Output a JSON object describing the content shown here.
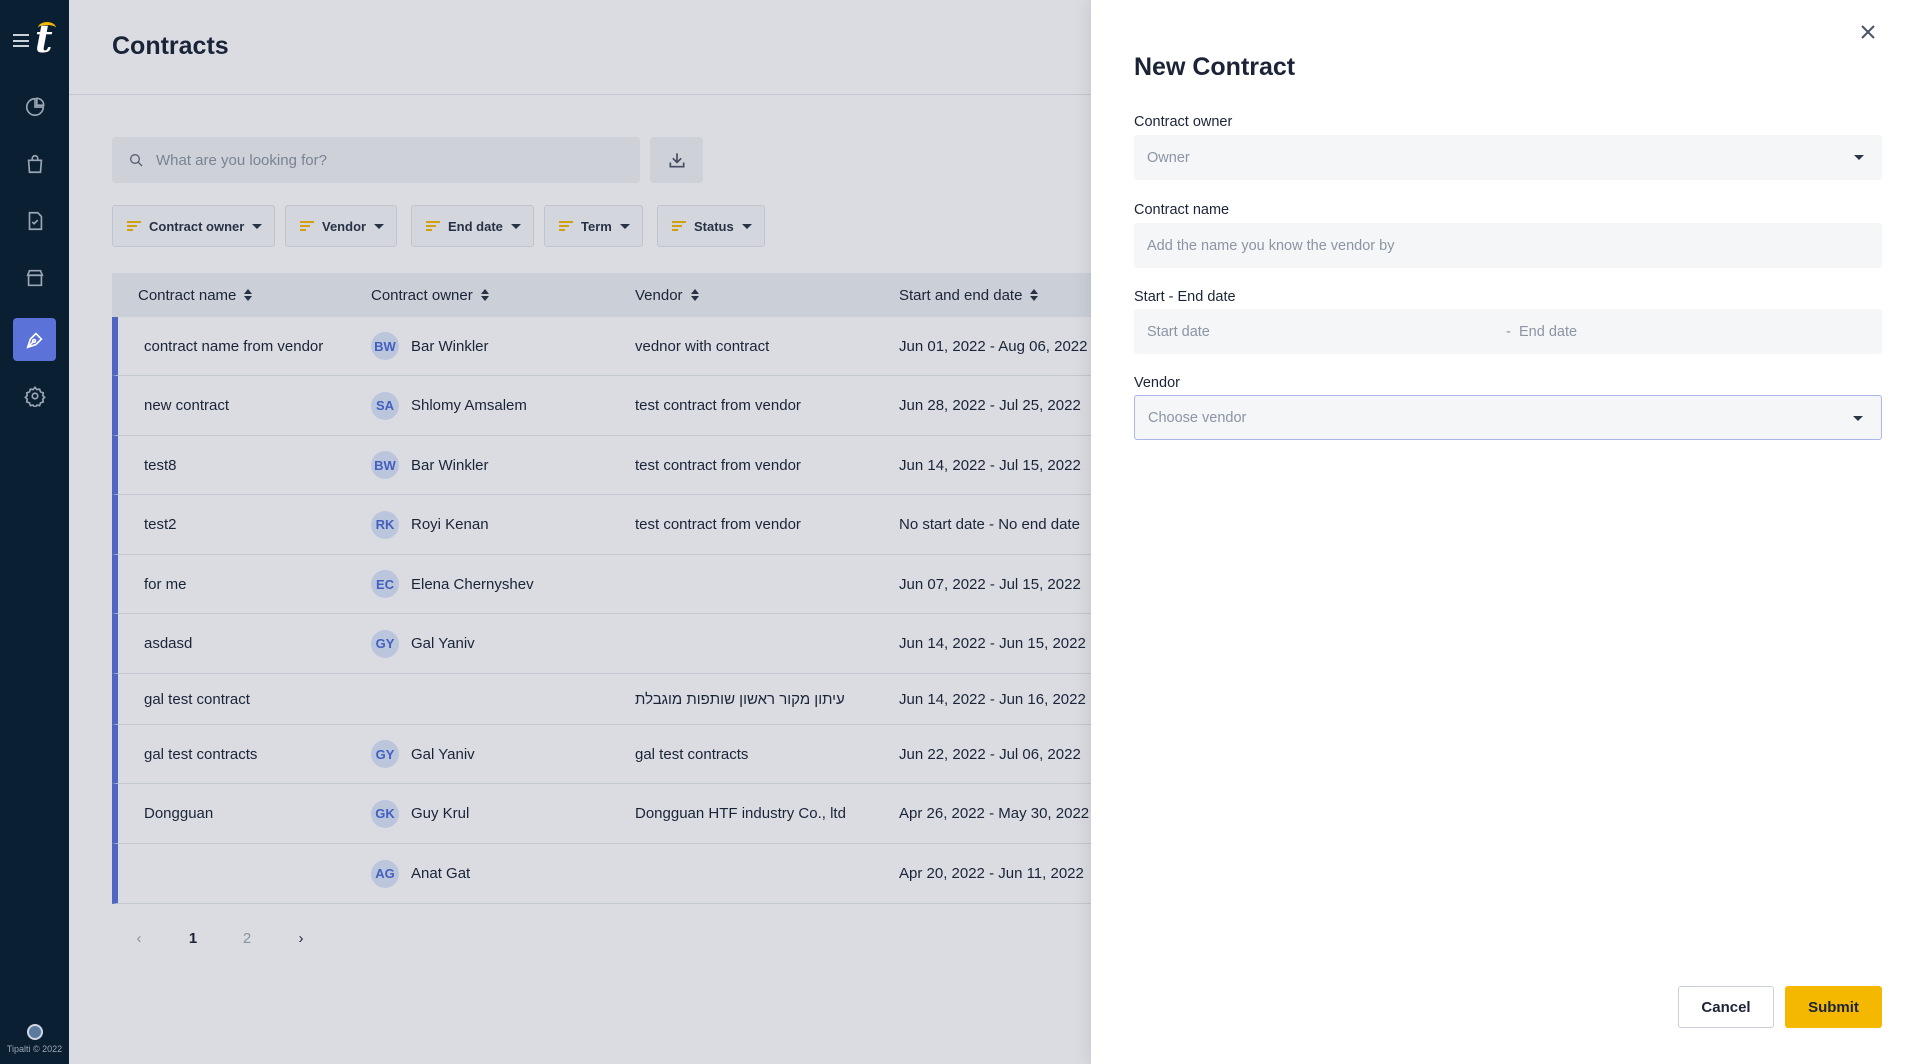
{
  "sidebar": {
    "logo_text": "t",
    "footer_text": "Tipalti © 2022",
    "nav_icons": [
      "pie-chart-icon",
      "shopping-bag-icon",
      "document-check-icon",
      "store-icon",
      "pen-icon",
      "gear-icon"
    ],
    "active_item": "pen-icon"
  },
  "page": {
    "title": "Contracts",
    "search_placeholder": "What are you looking for?",
    "filters": [
      "Contract owner",
      "Vendor",
      "End date",
      "Term",
      "Status"
    ]
  },
  "table": {
    "columns": [
      "Contract name",
      "Contract owner",
      "Vendor",
      "Start and end date"
    ],
    "rows": [
      {
        "name": "contract name from vendor",
        "initials": "BW",
        "owner": "Bar Winkler",
        "vendor": "vednor with contract",
        "dates": "Jun 01, 2022 - Aug 06, 2022"
      },
      {
        "name": "new contract",
        "initials": "SA",
        "owner": "Shlomy Amsalem",
        "vendor": "test contract from vendor",
        "dates": "Jun 28, 2022 - Jul 25, 2022"
      },
      {
        "name": "test8",
        "initials": "BW",
        "owner": "Bar Winkler",
        "vendor": "test contract from vendor",
        "dates": "Jun 14, 2022 - Jul 15, 2022"
      },
      {
        "name": "test2",
        "initials": "RK",
        "owner": "Royi Kenan",
        "vendor": "test contract from vendor",
        "dates": "No start date - No end date"
      },
      {
        "name": "for me",
        "initials": "EC",
        "owner": "Elena Chernyshev",
        "vendor": "",
        "dates": "Jun 07, 2022 - Jul 15, 2022"
      },
      {
        "name": "asdasd",
        "initials": "GY",
        "owner": "Gal Yaniv",
        "vendor": "",
        "dates": "Jun 14, 2022 - Jun 15, 2022"
      },
      {
        "name": "gal test contract",
        "initials": "",
        "owner": "",
        "vendor": "עיתון מקור ראשון שותפות מוגבלת",
        "dates": "Jun 14, 2022 - Jun 16, 2022"
      },
      {
        "name": "gal test contracts",
        "initials": "GY",
        "owner": "Gal Yaniv",
        "vendor": "gal test contracts",
        "dates": "Jun 22, 2022 - Jul 06, 2022"
      },
      {
        "name": "Dongguan",
        "initials": "GK",
        "owner": "Guy Krul",
        "vendor": "Dongguan HTF industry Co., ltd",
        "dates": "Apr 26, 2022 - May 30, 2022"
      },
      {
        "name": "",
        "initials": "AG",
        "owner": "Anat Gat",
        "vendor": "",
        "dates": "Apr 20, 2022 - Jun 11, 2022"
      }
    ]
  },
  "pagination": {
    "pages": [
      "1",
      "2"
    ],
    "current": "1"
  },
  "drawer": {
    "title": "New Contract",
    "owner_label": "Contract owner",
    "owner_placeholder": "Owner",
    "name_label": "Contract name",
    "name_placeholder": "Add the name you know the vendor by",
    "dates_label": "Start - End date",
    "start_placeholder": "Start date",
    "date_separator": "-",
    "end_placeholder": "End date",
    "vendor_label": "Vendor",
    "vendor_placeholder": "Choose vendor",
    "cancel_label": "Cancel",
    "submit_label": "Submit"
  },
  "colors": {
    "sidebar": "#0b1f33",
    "accent": "#5b72d9",
    "brand_yellow": "#f5b800"
  }
}
